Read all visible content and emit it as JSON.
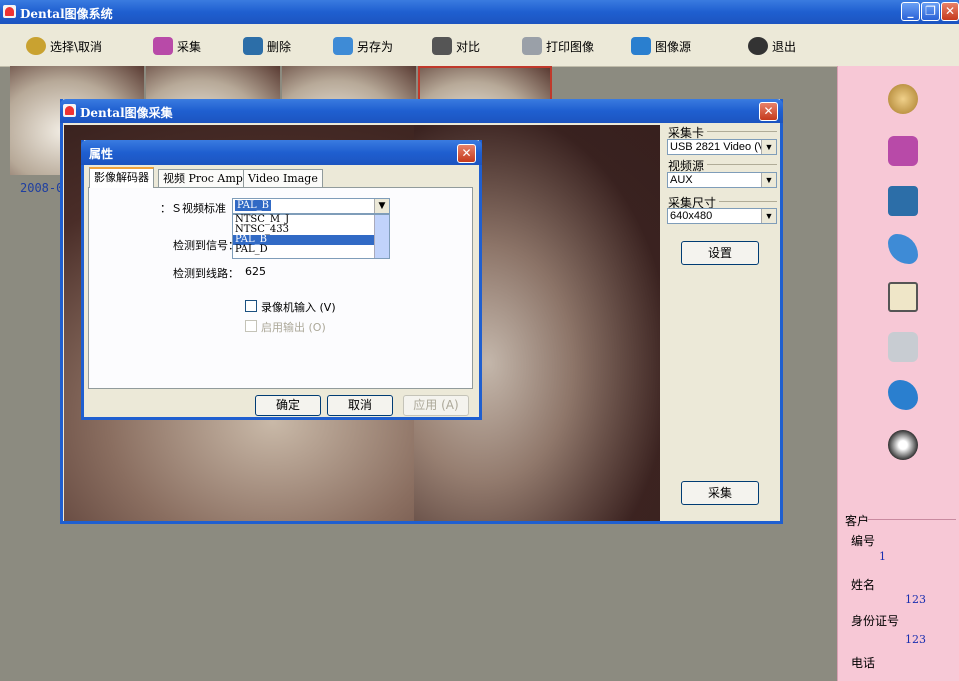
{
  "app": {
    "title": "Dental图像系统"
  },
  "toolbar": {
    "items": [
      {
        "label": "选择\\取消",
        "icon": "select-icon",
        "color": "#c9a230"
      },
      {
        "label": "采集",
        "icon": "capture-icon",
        "color": "#b84aa8"
      },
      {
        "label": "删除",
        "icon": "delete-icon",
        "color": "#2c6ea8"
      },
      {
        "label": "另存为",
        "icon": "save-as-icon",
        "color": "#3e8bd6"
      },
      {
        "label": "对比",
        "icon": "compare-icon",
        "color": "#555555"
      },
      {
        "label": "打印图像",
        "icon": "print-icon",
        "color": "#9aa0a8"
      },
      {
        "label": "图像源",
        "icon": "image-source-icon",
        "color": "#2a7fcf"
      },
      {
        "label": "退出",
        "icon": "exit-icon",
        "color": "#333333"
      }
    ]
  },
  "thumbnails": {
    "date": "2008-0"
  },
  "capture_window": {
    "title": "Dental图像采集",
    "capture_card_label": "采集卡",
    "capture_card_value": "USB 2821 Video (V",
    "video_source_label": "视频源",
    "video_source_value": "AUX",
    "capture_size_label": "采集尺寸",
    "capture_size_value": "640x480",
    "settings_button": "设置",
    "capture_button": "采集"
  },
  "properties_dialog": {
    "title": "属性",
    "tabs": [
      "影像解码器",
      "视频 Proc Amp",
      "Video Image"
    ],
    "video_standard_label": "：Ｓ视频标准（",
    "video_standard_value": "PAL_B",
    "standard_options": [
      "NTSC_M_J",
      "NTSC_433",
      "PAL_B",
      "PAL_D"
    ],
    "selected_option_index": 2,
    "signal_detected_label": "检测到信号：",
    "lines_detected_label": "检测到线路：",
    "lines_detected_value": "625",
    "vcr_input_label": "录像机输入 (V)",
    "enable_output_label": "启用输出 (O)",
    "ok_button": "确定",
    "cancel_button": "取消",
    "apply_button": "应用 (A)"
  },
  "customer": {
    "section_label": "客户",
    "id_label": "编号",
    "id_value": "1",
    "name_label": "姓名",
    "name_value": "123",
    "idcard_label": "身份证号",
    "idcard_value": "123",
    "phone_label": "电话"
  },
  "sidebar": {
    "icons": [
      "film-reel-icon",
      "capture-icon",
      "delete-icon",
      "save-as-icon",
      "compare-icon",
      "print-icon",
      "image-source-icon",
      "exit-icon"
    ]
  }
}
